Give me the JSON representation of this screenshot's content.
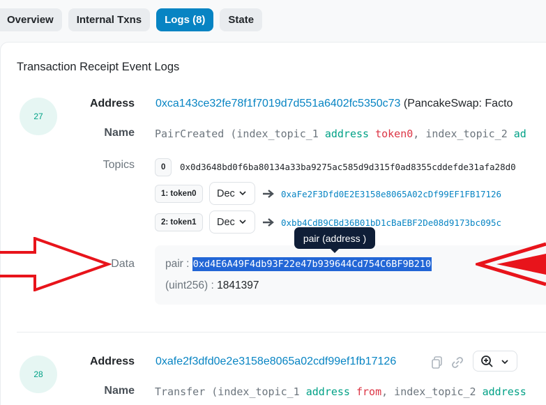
{
  "tabs": [
    {
      "label": "Overview",
      "active": false
    },
    {
      "label": "Internal Txns",
      "active": false
    },
    {
      "label": "Logs (8)",
      "active": true
    },
    {
      "label": "State",
      "active": false
    }
  ],
  "section_title": "Transaction Receipt Event Logs",
  "logs": [
    {
      "index": "27",
      "address_label": "Address",
      "address": "0xca143ce32fe78f1f7019d7d551a6402fc5350c73",
      "address_suffix": "(PancakeSwap: Facto",
      "name_label": "Name",
      "name_fn": "PairCreated (index_topic_1 ",
      "name_kw1": "address",
      "name_var1": "token0",
      "name_mid": ", index_topic_2 ",
      "name_kw2": "ad",
      "topics_label": "Topics",
      "topics": [
        {
          "idx": "0",
          "value": "0x0d3648bd0f6ba80134a33ba9275ac585d9d315f0ad8355cddefde31afa28d0"
        },
        {
          "idx": "1: token0",
          "format": "Dec",
          "value": "0xaFe2F3Dfd0E2E3158e8065A02cDf99EF1FB17126"
        },
        {
          "idx": "2: token1",
          "format": "Dec",
          "value": "0xbb4CdB9CBd36B01bD1cBaEBF2De08d9173bc095c"
        }
      ],
      "data_label": "Data",
      "data_pair_label": "pair : ",
      "data_pair_value": "0xd4E6A49F4db93F22e47b939644Cd754C6BF9B210",
      "data_uint_label": "(uint256) : ",
      "data_uint_value": "1841397",
      "tooltip": "pair (address )"
    },
    {
      "index": "28",
      "address_label": "Address",
      "address": "0xafe2f3dfd0e2e3158e8065a02cdf99ef1fb17126",
      "name_label": "Name",
      "name_fn": "Transfer (index_topic_1 ",
      "name_kw1": "address",
      "name_var1": "from",
      "name_mid": ", index_topic_2 ",
      "name_kw2": "address"
    }
  ],
  "icons": [
    "arrow-right-icon",
    "chevron-down-icon",
    "copy-icon",
    "link-icon",
    "zoom-in-icon",
    "annotation-arrow-left",
    "annotation-arrow-right"
  ],
  "colors": {
    "accent": "#0784c3",
    "annotation": "#e8141b",
    "keyword": "#00a186",
    "variable": "#dc3545"
  }
}
